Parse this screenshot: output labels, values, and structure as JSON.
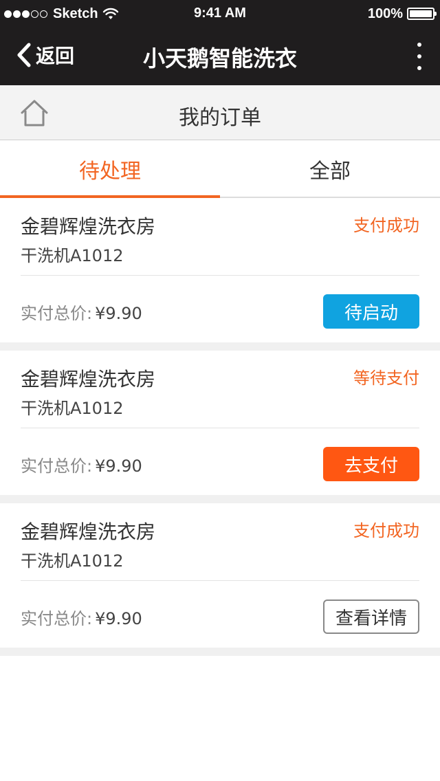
{
  "status_bar": {
    "carrier": "Sketch",
    "time": "9:41 AM",
    "battery": "100%"
  },
  "nav": {
    "back_label": "返回",
    "title": "小天鹅智能洗衣"
  },
  "sub_header": {
    "title": "我的订单"
  },
  "tabs": [
    {
      "label": "待处理",
      "active": true
    },
    {
      "label": "全部",
      "active": false
    }
  ],
  "orders": [
    {
      "store": "金碧辉煌洗衣房",
      "machine": "干洗机A1012",
      "status": "支付成功",
      "price_label": "实付总价:",
      "price": "¥9.90",
      "action": "待启动",
      "action_style": "blue"
    },
    {
      "store": "金碧辉煌洗衣房",
      "machine": "干洗机A1012",
      "status": "等待支付",
      "price_label": "实付总价:",
      "price": "¥9.90",
      "action": "去支付",
      "action_style": "orange"
    },
    {
      "store": "金碧辉煌洗衣房",
      "machine": "干洗机A1012",
      "status": "支付成功",
      "price_label": "实付总价:",
      "price": "¥9.90",
      "action": "查看详情",
      "action_style": "outline"
    }
  ],
  "colors": {
    "nav_bg": "#1f1d1e",
    "accent": "#f26522",
    "blue_button": "#10a3e0",
    "orange_button": "#ff5712"
  }
}
